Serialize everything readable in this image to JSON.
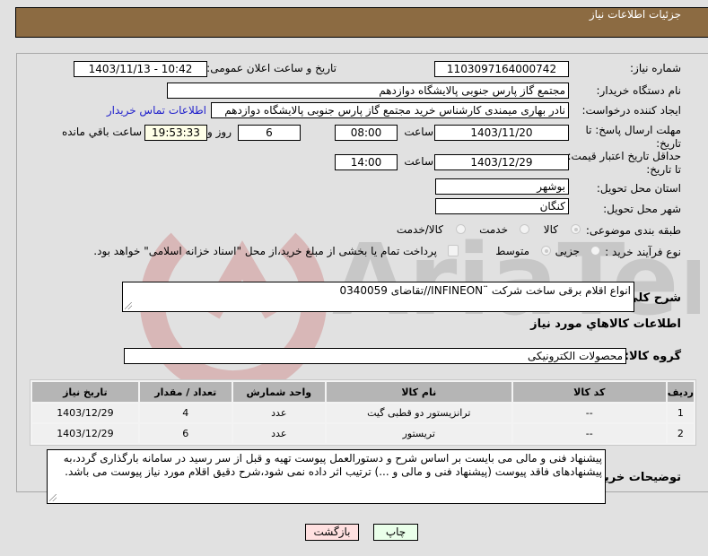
{
  "header": {
    "title": "جزئیات اطلاعات نیاز"
  },
  "form": {
    "need_number": {
      "label": "شماره نیاز:",
      "value": "1103097164000742"
    },
    "announce_datetime": {
      "label": "تاریخ و ساعت اعلان عمومی:",
      "value": "1403/11/13 - 10:42"
    },
    "buyer_org": {
      "label": "نام دستگاه خریدار:",
      "value": "مجتمع گاز پارس جنوبی  پالایشگاه دوازدهم"
    },
    "requester": {
      "label": "ایجاد کننده درخواست:",
      "value": "نادر بهاری میمندی کارشناس خرید مجتمع گاز پارس جنوبی  پالایشگاه دوازدهم",
      "contact_link": "اطلاعات تماس خریدار"
    },
    "reply_deadline": {
      "label": "مهلت ارسال پاسخ: تا تاریخ:",
      "date": "1403/11/20",
      "time_label": "ساعت",
      "time": "08:00",
      "days": "6",
      "days_label": "روز و",
      "remaining": "19:53:33",
      "remaining_label": "ساعت باقي مانده"
    },
    "price_validity": {
      "label": "حداقل تاریخ اعتبار قیمت: تا تاریخ:",
      "date": "1403/12/29",
      "time_label": "ساعت",
      "time": "14:00"
    },
    "province": {
      "label": "استان محل تحویل:",
      "value": "بوشهر"
    },
    "city": {
      "label": "شهر محل تحویل:",
      "value": "کنگان"
    },
    "category": {
      "label": "طبقه بندی موضوعی:",
      "options": [
        "کالا",
        "خدمت",
        "کالا/خدمت"
      ],
      "selected": "کالا"
    },
    "purchase_type": {
      "label": "نوع فرآیند خرید :",
      "options": [
        "جزیی",
        "متوسط"
      ],
      "selected": "متوسط",
      "treasury_checkbox": "پرداخت تمام یا بخشی از مبلغ خرید،از محل \"اسناد خزانه اسلامی\" خواهد بود.",
      "treasury_checked": false
    },
    "general_desc": {
      "label": "شرح کلي نياز:",
      "value": "انواع اقلام برقی ساخت شرکت ¨INFINEON//تقاضای 0340059"
    }
  },
  "items_section": {
    "title": "اطلاعات کالاهاي مورد نياز",
    "group_label": "گروه کالا:",
    "group_value": "محصولات الکترونیکی",
    "columns": [
      "ردیف",
      "کد کالا",
      "نام کالا",
      "واحد شمارش",
      "تعداد / مقدار",
      "تاریخ نیاز"
    ],
    "rows": [
      {
        "index": "1",
        "code": "--",
        "name": "ترانزیستور دو قطبی گیت",
        "unit": "عدد",
        "qty": "4",
        "date": "1403/12/29"
      },
      {
        "index": "2",
        "code": "--",
        "name": "تریستور",
        "unit": "عدد",
        "qty": "6",
        "date": "1403/12/29"
      }
    ]
  },
  "buyer_notes": {
    "label": "توضیحات خریدار:",
    "value": "پیشنهاد فنی و مالی می بایست بر اساس شرح و دستورالعمل پیوست تهیه و قبل از سر رسید در سامانه بارگذاری گردد،به پیشنهادهای فاقد پیوست (پیشنهاد فنی و مالی و ...) ترتیب اثر داده نمی شود،شرح دقیق اقلام مورد نیاز پیوست می باشد."
  },
  "buttons": {
    "print": "چاپ",
    "back": "بازگشت"
  },
  "colors": {
    "header_bg": "#8c6b42",
    "link": "#2222cc",
    "print_bg": "#eaffea",
    "back_bg": "#ffe0e0",
    "remaining_bg": "#ffffe8"
  }
}
